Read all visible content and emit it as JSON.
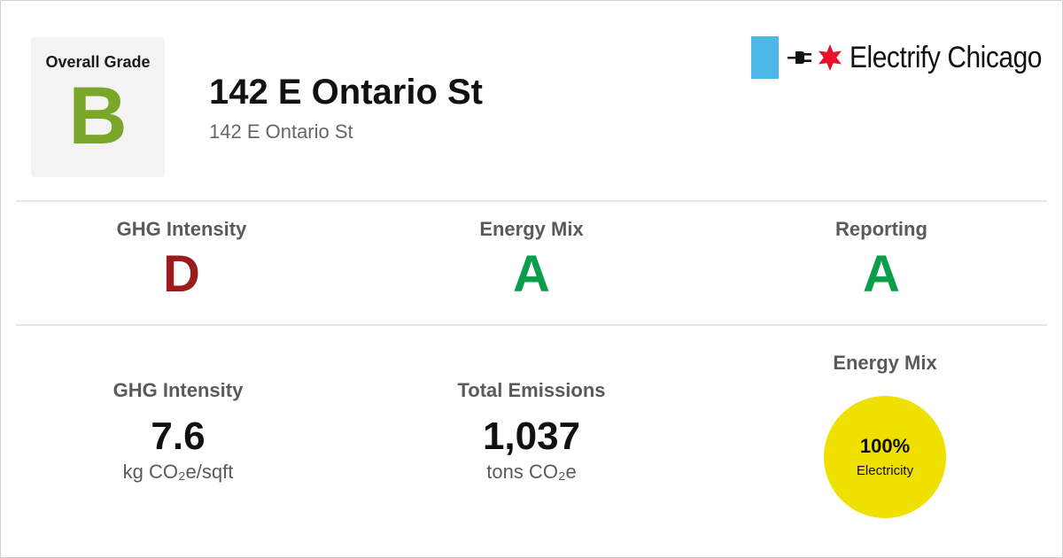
{
  "header": {
    "overall_grade_label": "Overall Grade",
    "overall_grade": "B",
    "title": "142 E Ontario St",
    "subtitle": "142 E Ontario St",
    "brand": "Electrify Chicago"
  },
  "grades": [
    {
      "label": "GHG Intensity",
      "grade": "D",
      "color": "#9b1c1c"
    },
    {
      "label": "Energy Mix",
      "grade": "A",
      "color": "#0a9e4a"
    },
    {
      "label": "Reporting",
      "grade": "A",
      "color": "#0a9e4a"
    }
  ],
  "stats": {
    "ghg_intensity": {
      "label": "GHG Intensity",
      "value": "7.6",
      "unit": "kg CO₂e/sqft"
    },
    "total_emissions": {
      "label": "Total Emissions",
      "value": "1,037",
      "unit": "tons CO₂e"
    },
    "energy_mix": {
      "label": "Energy Mix",
      "percent": "100%",
      "source": "Electricity",
      "color": "#f0e000"
    }
  },
  "colors": {
    "overall_grade": "#7aa629",
    "brand_blue": "#4db8e8",
    "brand_red": "#e8112d"
  },
  "icons": [
    "plug-icon",
    "chicago-star-icon"
  ]
}
